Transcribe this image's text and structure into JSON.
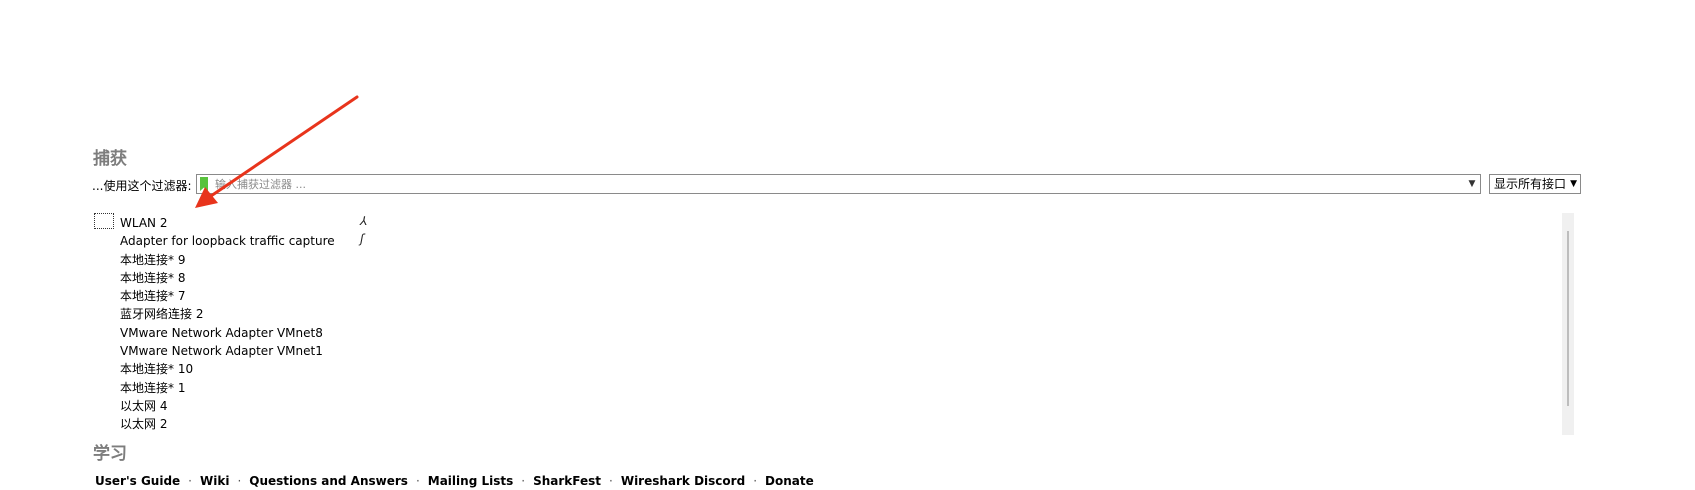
{
  "capture": {
    "title": "捕获",
    "filter_label": "...使用这个过滤器:",
    "filter_placeholder": "输入捕获过滤器 ...",
    "interface_select": "显示所有接口"
  },
  "interfaces": [
    "WLAN 2",
    "Adapter for loopback traffic capture",
    "本地连接* 9",
    "本地连接* 8",
    "本地连接* 7",
    "蓝牙网络连接 2",
    "VMware Network Adapter VMnet8",
    "VMware Network Adapter VMnet1",
    "本地连接* 10",
    "本地连接* 1",
    "以太网 4",
    "以太网 2"
  ],
  "sparklines": [
    "⅄",
    "ʃ"
  ],
  "learn": {
    "title": "学习",
    "links": [
      "User's Guide",
      "Wiki",
      "Questions and Answers",
      "Mailing Lists",
      "SharkFest",
      "Wireshark Discord",
      "Donate"
    ],
    "separator": "·"
  },
  "colors": {
    "annotation_arrow": "#e8341c",
    "bookmark": "#58c23c"
  },
  "icons": {
    "bookmark": "bookmark-icon",
    "dropdown": "chevron-down-icon"
  }
}
